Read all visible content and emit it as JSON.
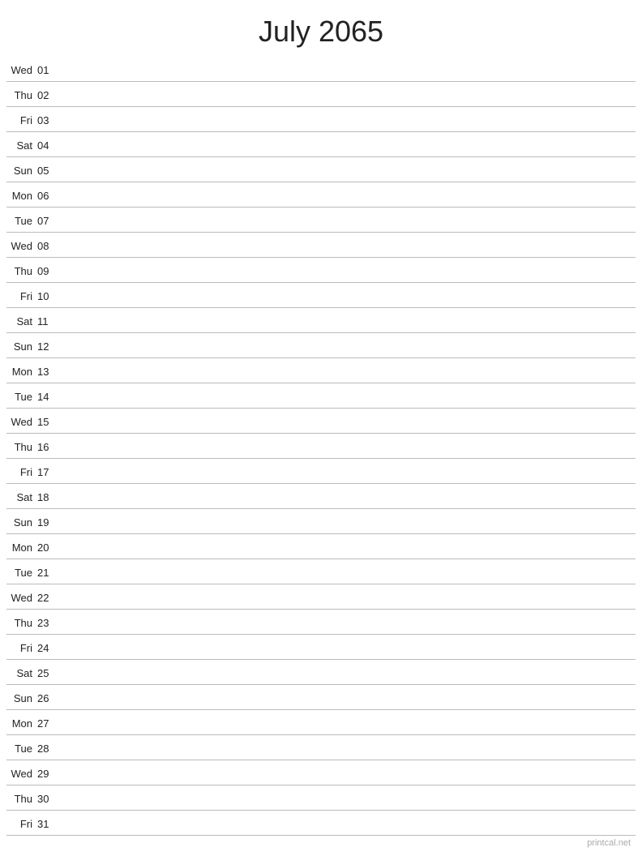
{
  "title": "July 2065",
  "days": [
    {
      "name": "Wed",
      "num": "01"
    },
    {
      "name": "Thu",
      "num": "02"
    },
    {
      "name": "Fri",
      "num": "03"
    },
    {
      "name": "Sat",
      "num": "04"
    },
    {
      "name": "Sun",
      "num": "05"
    },
    {
      "name": "Mon",
      "num": "06"
    },
    {
      "name": "Tue",
      "num": "07"
    },
    {
      "name": "Wed",
      "num": "08"
    },
    {
      "name": "Thu",
      "num": "09"
    },
    {
      "name": "Fri",
      "num": "10"
    },
    {
      "name": "Sat",
      "num": "11"
    },
    {
      "name": "Sun",
      "num": "12"
    },
    {
      "name": "Mon",
      "num": "13"
    },
    {
      "name": "Tue",
      "num": "14"
    },
    {
      "name": "Wed",
      "num": "15"
    },
    {
      "name": "Thu",
      "num": "16"
    },
    {
      "name": "Fri",
      "num": "17"
    },
    {
      "name": "Sat",
      "num": "18"
    },
    {
      "name": "Sun",
      "num": "19"
    },
    {
      "name": "Mon",
      "num": "20"
    },
    {
      "name": "Tue",
      "num": "21"
    },
    {
      "name": "Wed",
      "num": "22"
    },
    {
      "name": "Thu",
      "num": "23"
    },
    {
      "name": "Fri",
      "num": "24"
    },
    {
      "name": "Sat",
      "num": "25"
    },
    {
      "name": "Sun",
      "num": "26"
    },
    {
      "name": "Mon",
      "num": "27"
    },
    {
      "name": "Tue",
      "num": "28"
    },
    {
      "name": "Wed",
      "num": "29"
    },
    {
      "name": "Thu",
      "num": "30"
    },
    {
      "name": "Fri",
      "num": "31"
    }
  ],
  "watermark": "printcal.net"
}
